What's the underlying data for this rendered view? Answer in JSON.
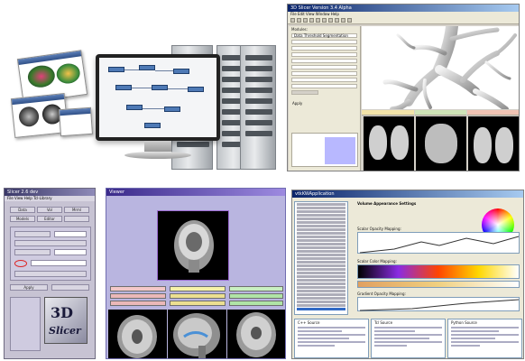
{
  "collage": {
    "panel_count": 5
  },
  "slicer3": {
    "window_title": "3D Slicer Version 3.4 Alpha",
    "menu": "File  Edit  View  Window  Help",
    "module_label": "Modules:",
    "module_value": "Data Threshold Segmentation",
    "apply_label": "Apply",
    "colors": {
      "titlebar": "#0a246a",
      "airway": "#d9d9d9"
    }
  },
  "slicer2": {
    "window_title": "Slicer 2.6 dev",
    "menu": "File  View  Help  Tcl-Library",
    "buttons": [
      "Data",
      "Vol",
      "Mrml",
      "Models",
      "Editor",
      "Apply"
    ],
    "logo_text": "3D",
    "logo_text2": "Slicer"
  },
  "viewer": {
    "window_title": "Viewer",
    "colors": {
      "background": "#b9b5e0",
      "frame": "#9a6ad0"
    }
  },
  "appearance": {
    "window_title": "vtkKWApplication",
    "section_title": "Volume Appearance Settings",
    "scalar_opacity": "Scalar Opacity Mapping:",
    "scalar_color": "Scalar Color Mapping:",
    "gradient_opacity": "Gradient Opacity Mapping:",
    "pane_titles": [
      "C++ Source",
      "Tcl Source",
      "Python Source"
    ],
    "colors": {
      "selected_row": "#316ac5"
    }
  }
}
